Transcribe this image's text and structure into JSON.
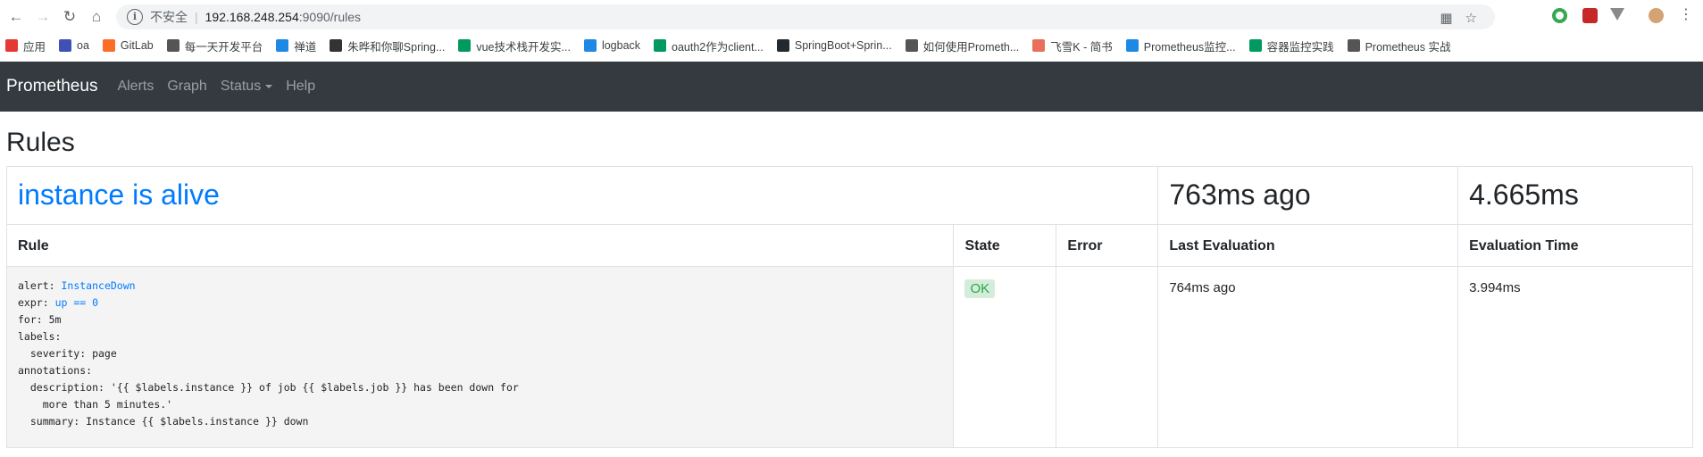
{
  "browser": {
    "insecure_label": "不安全",
    "url_host": "192.168.248.254",
    "url_path": ":9090/rules",
    "bookmarks": [
      {
        "label": "应用",
        "icon": "apps-grid-icon",
        "color": "#e53935"
      },
      {
        "label": "oa",
        "icon": "td-icon",
        "color": "#3f51b5"
      },
      {
        "label": "GitLab",
        "icon": "gitlab-icon",
        "color": "#fc6d26"
      },
      {
        "label": "每一天开发平台",
        "icon": "globe-icon",
        "color": "#555555"
      },
      {
        "label": "禅道",
        "icon": "zentao-icon",
        "color": "#1e88e5"
      },
      {
        "label": "朱晔和你聊Spring...",
        "icon": "lambda-icon",
        "color": "#333333"
      },
      {
        "label": "vue技术栈开发实...",
        "icon": "sf-icon",
        "color": "#009a61"
      },
      {
        "label": "logback",
        "icon": "chevron-icon",
        "color": "#1e88e5"
      },
      {
        "label": "oauth2作为client...",
        "icon": "sf-icon",
        "color": "#009a61"
      },
      {
        "label": "SpringBoot+Sprin...",
        "icon": "github-icon",
        "color": "#24292e"
      },
      {
        "label": "如何使用Prometh...",
        "icon": "globe-icon",
        "color": "#555555"
      },
      {
        "label": "飞雪K - 简书",
        "icon": "jianshu-icon",
        "color": "#ea6f5a"
      },
      {
        "label": "Prometheus监控...",
        "icon": "cloud-icon",
        "color": "#1e88e5"
      },
      {
        "label": "容器监控实践",
        "icon": "sf-icon",
        "color": "#009a61"
      },
      {
        "label": "Prometheus 实战",
        "icon": "book-icon",
        "color": "#555555"
      }
    ]
  },
  "nav": {
    "brand": "Prometheus",
    "links": [
      "Alerts",
      "Graph",
      "Status",
      "Help"
    ]
  },
  "page": {
    "title": "Rules"
  },
  "group": {
    "name": "instance is alive",
    "last_evaluation": "763ms ago",
    "evaluation_time": "4.665ms"
  },
  "table": {
    "headers": [
      "Rule",
      "State",
      "Error",
      "Last Evaluation",
      "Evaluation Time"
    ]
  },
  "rule": {
    "alert_key": "alert:",
    "alert_name": "InstanceDown",
    "expr_key": "expr:",
    "expr_value": "up == 0",
    "lines": [
      "for: 5m",
      "labels:",
      "  severity: page",
      "annotations:",
      "  description: '{{ $labels.instance }} of job {{ $labels.job }} has been down for",
      "    more than 5 minutes.'",
      "  summary: Instance {{ $labels.instance }} down"
    ],
    "state": "OK",
    "error": "",
    "last_evaluation": "764ms ago",
    "evaluation_time": "3.994ms"
  }
}
